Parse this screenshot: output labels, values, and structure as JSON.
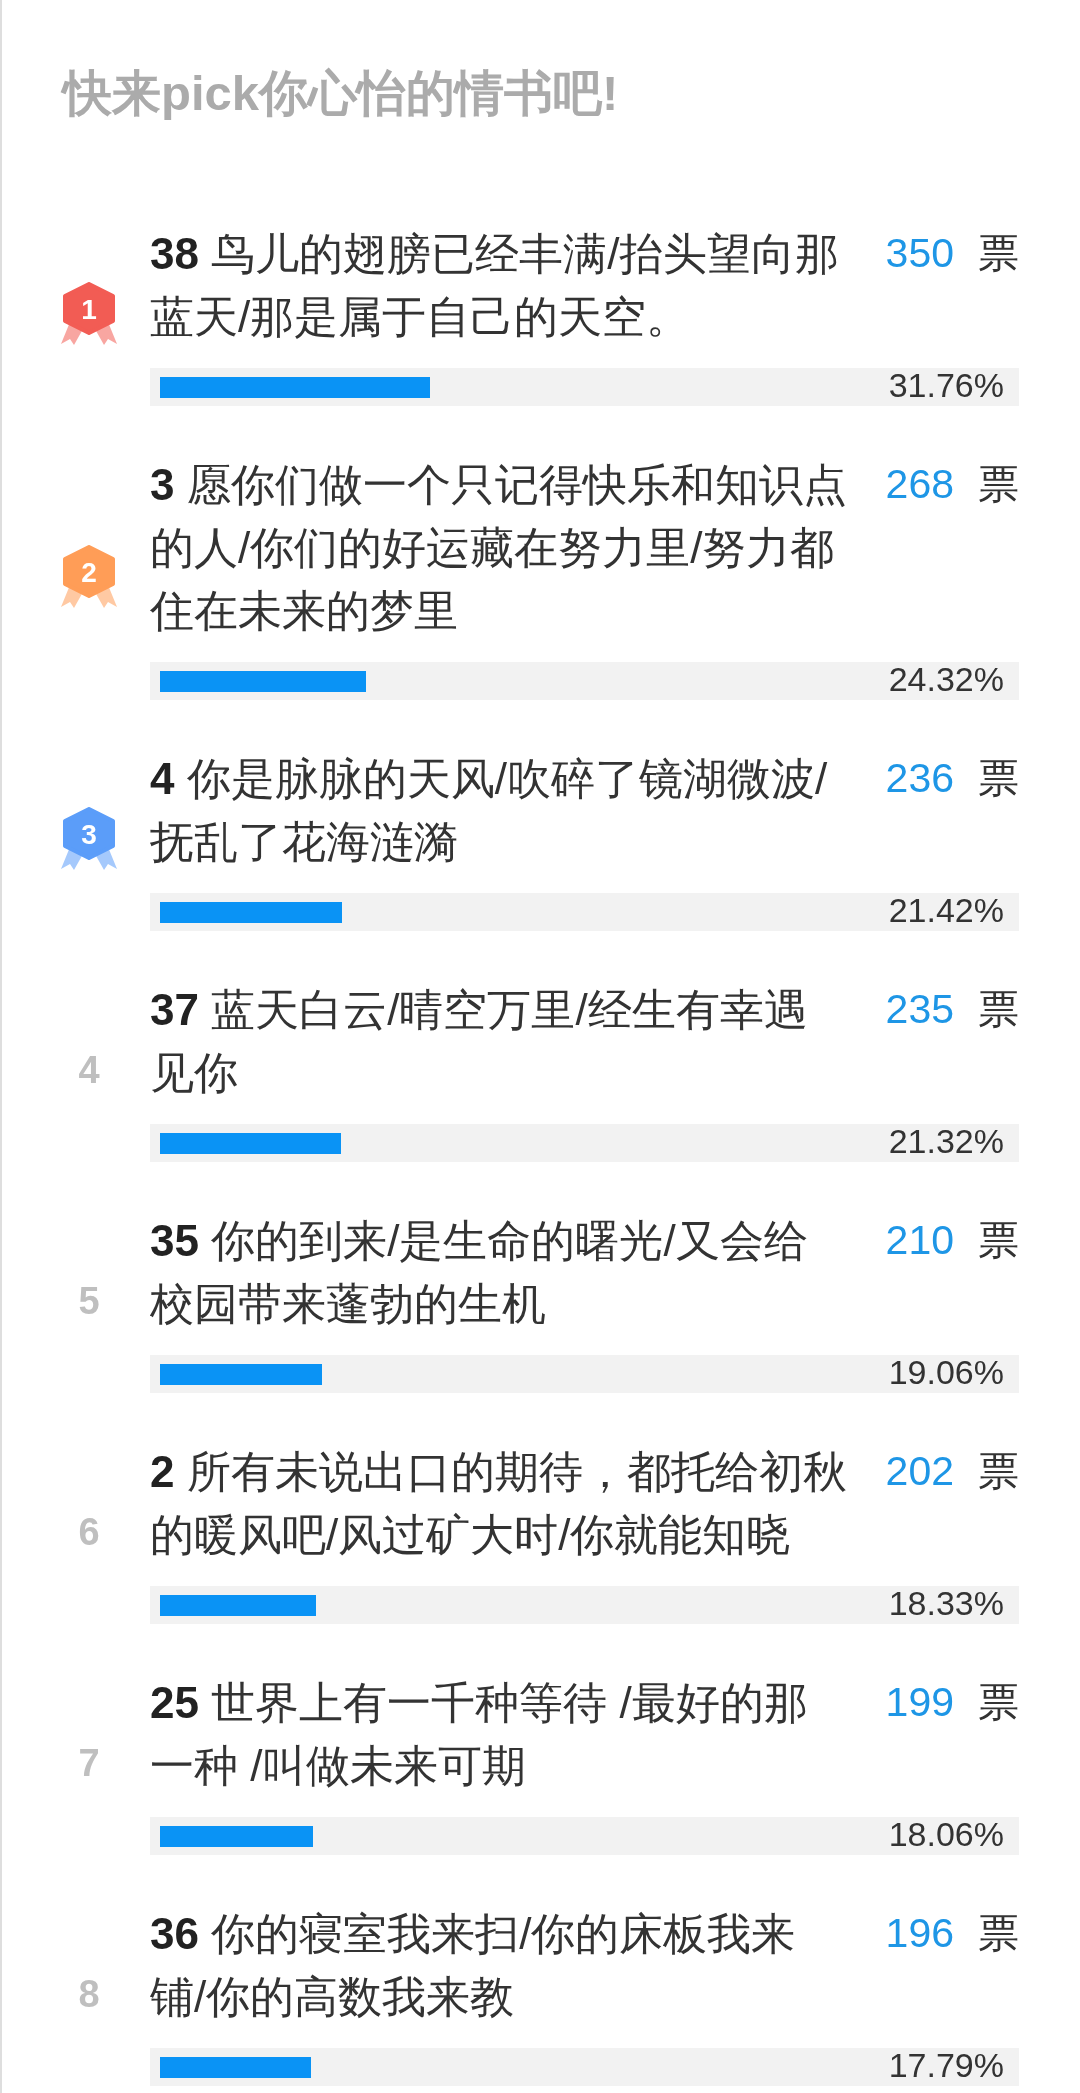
{
  "title": "快来pick你心怡的情书吧!",
  "options": [
    {
      "rank": "1",
      "kind": "medal",
      "color": "#f25c54",
      "text": "**38** 鸟儿的翅膀已经丰满/抬头望向那蓝天/那是属于自己的天空。",
      "votes": "350",
      "unit": "票",
      "level": 0.3176,
      "percent": "31.76%"
    },
    {
      "rank": "2",
      "kind": "medal",
      "color": "#ff9d57",
      "text": "**3** 愿你们做一个只记得快乐和知识点的人/你们的好运藏在努力里/努力都住在未来的梦里",
      "votes": "268",
      "unit": "票",
      "level": 0.2432,
      "percent": "24.32%"
    },
    {
      "rank": "3",
      "kind": "medal",
      "color": "#5b9df9",
      "text": "**4** 你是脉脉的天风/吹碎了镜湖微波/抚乱了花海涟漪",
      "votes": "236",
      "unit": "票",
      "level": 0.2142,
      "percent": "21.42%"
    },
    {
      "rank": "4",
      "kind": "number",
      "text": "**37** 蓝天白云/晴空万里/经生有幸遇见你",
      "votes": "235",
      "unit": "票",
      "level": 0.2132,
      "percent": "21.32%"
    },
    {
      "rank": "5",
      "kind": "number",
      "text": "**35** 你的到来/是生命的曙光/又会给校园带来蓬勃的生机",
      "votes": "210",
      "unit": "票",
      "level": 0.1906,
      "percent": "19.06%"
    },
    {
      "rank": "6",
      "kind": "number",
      "text": "**2** 所有未说出口的期待，都托给初秋的暖风吧/风过矿大时/你就能知晓",
      "votes": "202",
      "unit": "票",
      "level": 0.1833,
      "percent": "18.33%"
    },
    {
      "rank": "7",
      "kind": "number",
      "text": "**25** 世界上有一千种等待 /最好的那一种 /叫做未来可期",
      "votes": "199",
      "unit": "票",
      "level": 0.1806,
      "percent": "18.06%"
    },
    {
      "rank": "8",
      "kind": "number",
      "text": "**36** 你的寝室我来扫/你的床板我来铺/你的高数我来教",
      "votes": "196",
      "unit": "票",
      "level": 0.1779,
      "percent": "17.79%"
    }
  ]
}
